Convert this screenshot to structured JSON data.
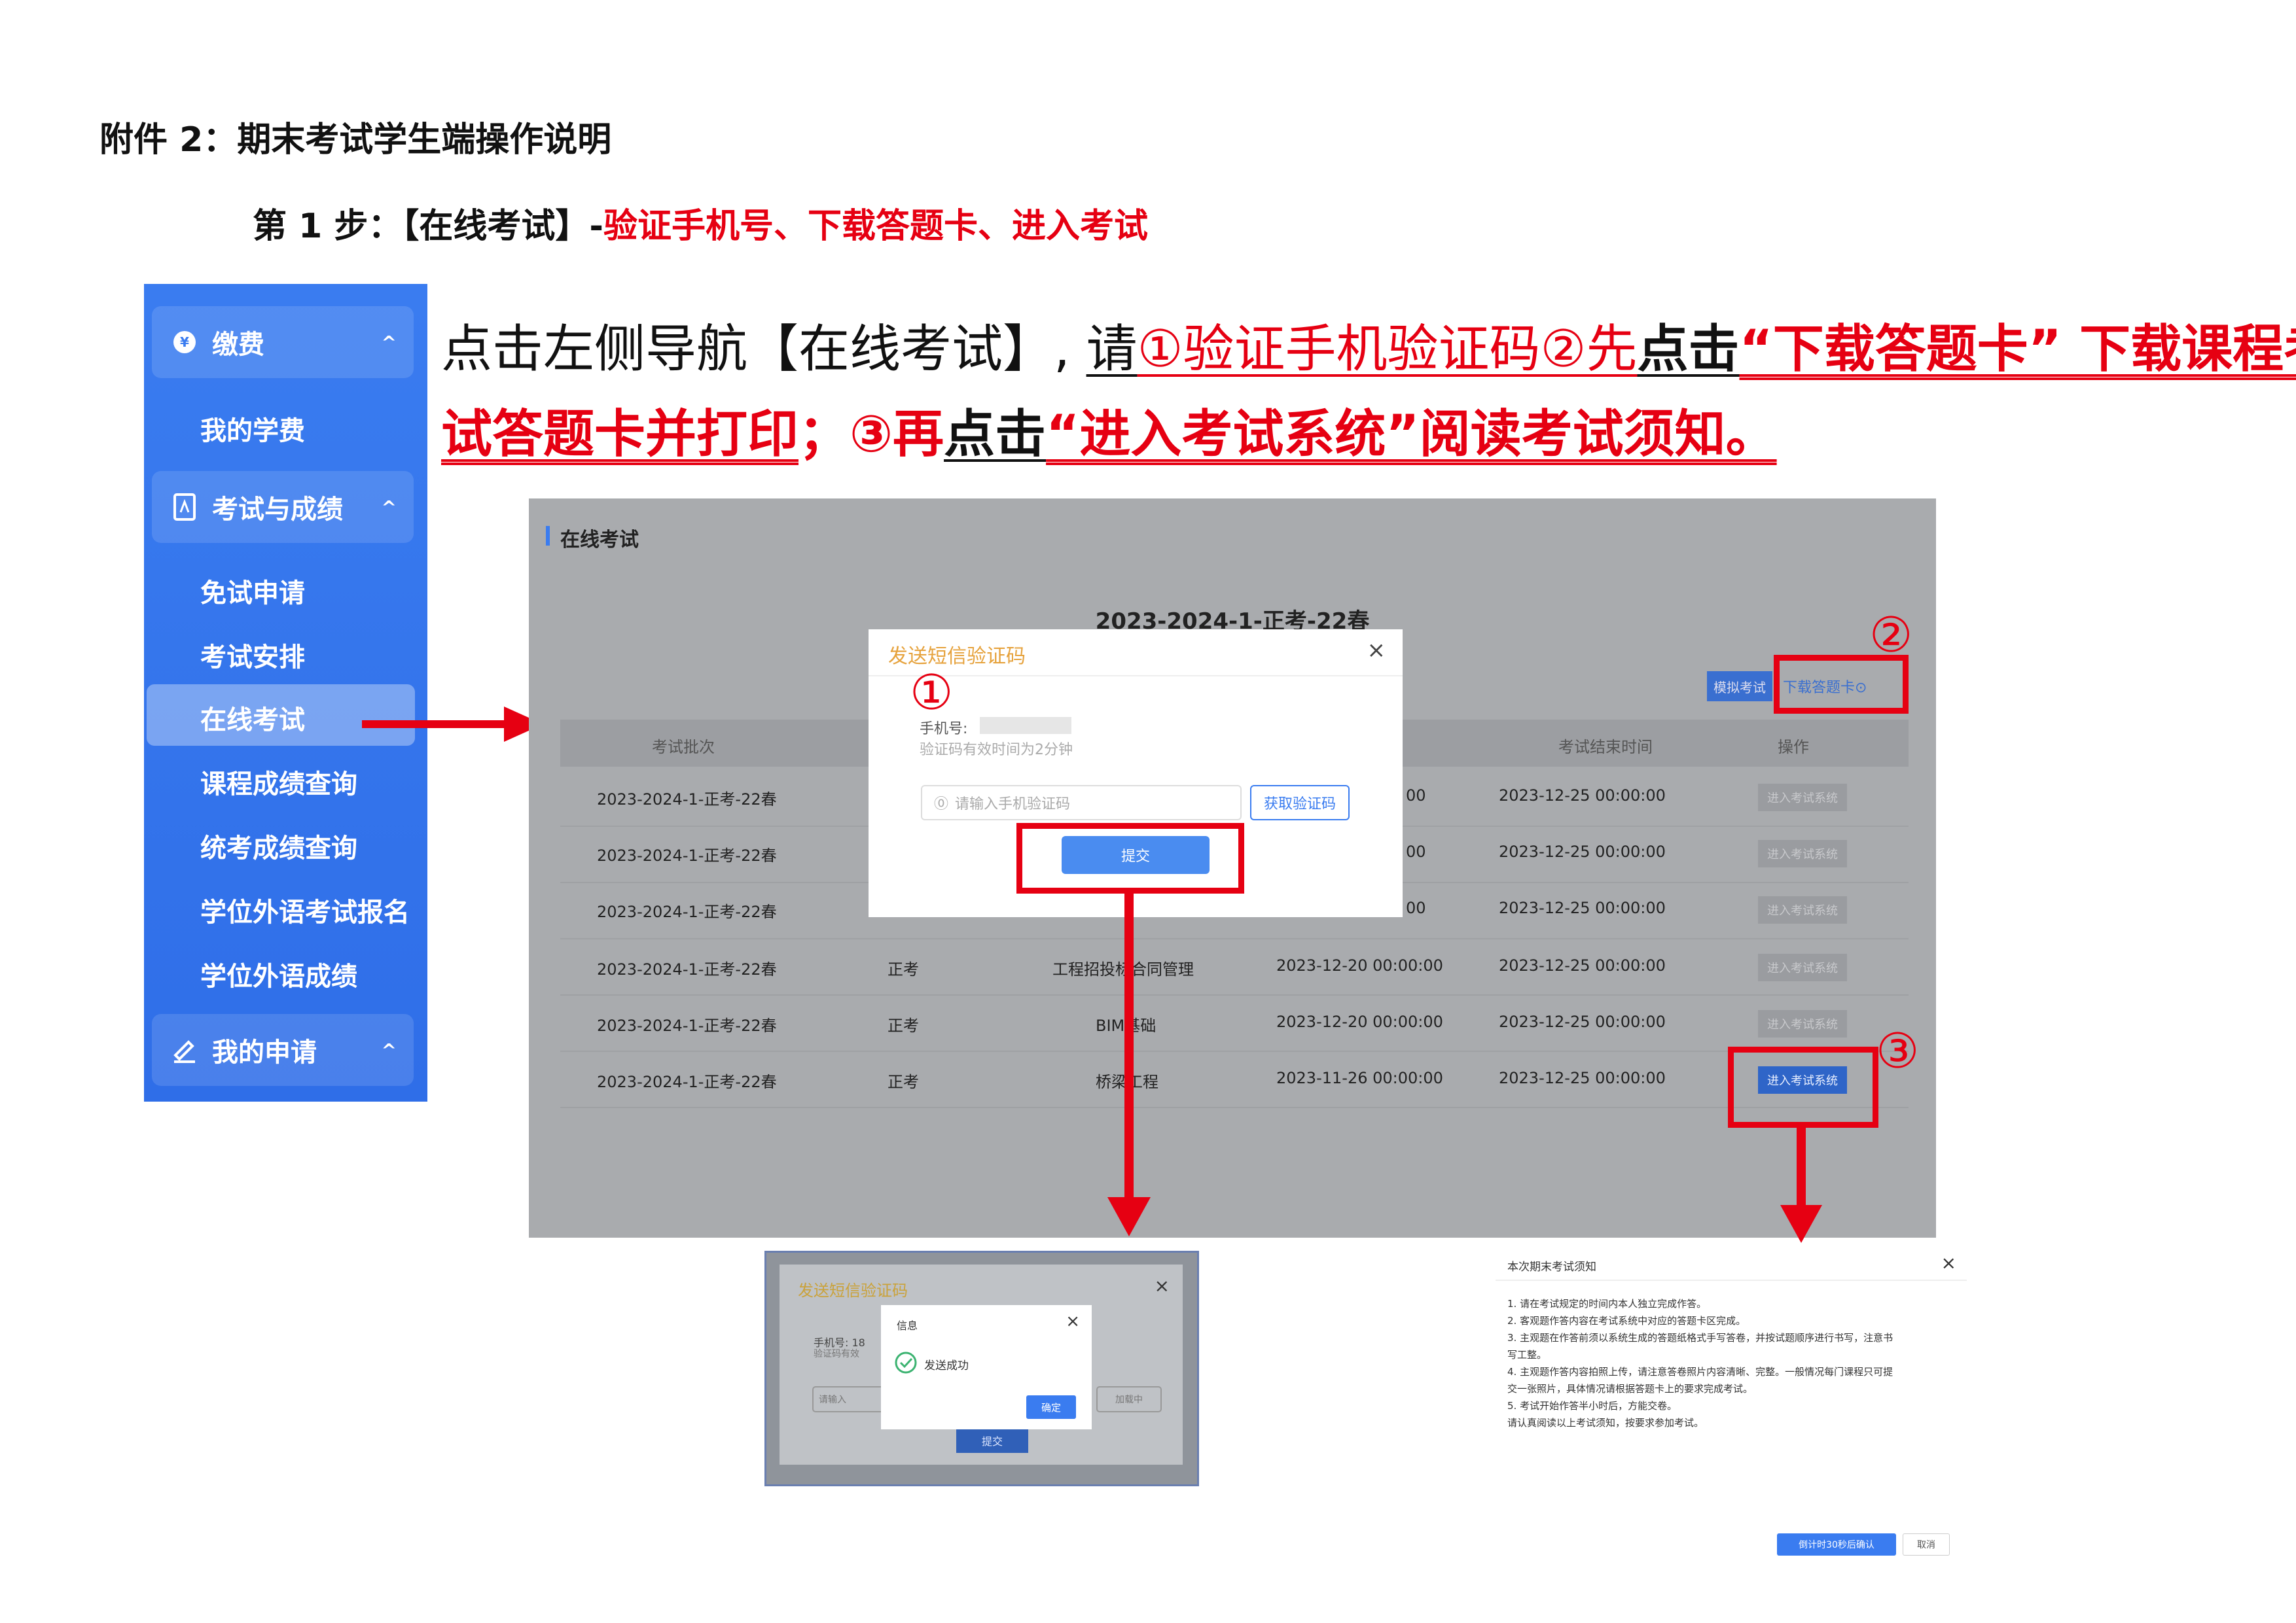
{
  "header": {
    "title": "附件 2：期末考试学生端操作说明",
    "step_prefix": "第 1 步：【在线考试】-",
    "step_red": "验证手机号、下载答题卡、进入考试"
  },
  "sidebar": {
    "groups": [
      {
        "label": "缴费",
        "icon": "coin-icon"
      },
      {
        "label": "考试与成绩",
        "icon": "document-icon"
      },
      {
        "label": "我的申请",
        "icon": "edit-icon"
      }
    ],
    "items": [
      "我的学费",
      "免试申请",
      "考试安排",
      "在线考试",
      "课程成绩查询",
      "统考成绩查询",
      "学位外语考试报名",
      "学位外语成绩"
    ],
    "chevron": "^"
  },
  "instruction": {
    "p1": "点击左侧导航【在线考试】, ",
    "p2": "请",
    "p3": "①验证手机验证码②先",
    "p4": "点击",
    "p5": "“下载答题卡” 下载课程考",
    "p6": "试答题卡并打印",
    "p7": "；③再",
    "p8": "点击",
    "p9": "“进入考试系统”阅读考试须知。"
  },
  "main": {
    "page_title": "在线考试",
    "batch": "2023-2024-1-正考-22春",
    "mock_btn": "模拟考试",
    "download_btn": "下载答题卡⊙",
    "headers": [
      "考试批次",
      "考试结束时间",
      "操作"
    ],
    "rows": [
      {
        "batch": "2023-2024-1-正考-22春",
        "type": "",
        "course": "",
        "start": "00",
        "end": "2023-12-25 00:00:00"
      },
      {
        "batch": "2023-2024-1-正考-22春",
        "type": "",
        "course": "",
        "start": "00",
        "end": "2023-12-25 00:00:00"
      },
      {
        "batch": "2023-2024-1-正考-22春",
        "type": "",
        "course": "",
        "start": "00",
        "end": "2023-12-25 00:00:00"
      },
      {
        "batch": "2023-2024-1-正考-22春",
        "type": "正考",
        "course": "工程招投标合同管理",
        "start": "2023-12-20 00:00:00",
        "end": "2023-12-25 00:00:00"
      },
      {
        "batch": "2023-2024-1-正考-22春",
        "type": "正考",
        "course": "BIM基础",
        "start": "2023-12-20 00:00:00",
        "end": "2023-12-25 00:00:00"
      },
      {
        "batch": "2023-2024-1-正考-22春",
        "type": "正考",
        "course": "桥梁工程",
        "start": "2023-11-26 00:00:00",
        "end": "2023-12-25 00:00:00"
      }
    ],
    "enter_btn": "进入考试系统",
    "modal": {
      "title": "发送短信验证码",
      "phone_label": "手机号:",
      "hint": "验证码有效时间为2分钟",
      "placeholder": "请输入手机验证码",
      "get_code": "获取验证码",
      "submit": "提交"
    },
    "markers": [
      "①",
      "②",
      "③"
    ]
  },
  "sms_success": {
    "title": "发送短信验证码",
    "phone": "手机号: 18",
    "hint": "验证码有效",
    "input": "请输入",
    "loading": "加载中",
    "dialog_title": "信息",
    "message": "发送成功",
    "ok": "确定",
    "submit": "提交"
  },
  "notice": {
    "title": "本次期末考试须知",
    "lines": [
      "1. 请在考试规定的时间内本人独立完成作答。",
      "2. 客观题作答内容在考试系统中对应的答题卡区完成。",
      "3. 主观题在作答前须以系统生成的答题纸格式手写答卷，并按试题顺序进行书写，注意书",
      "写工整。",
      "4. 主观题作答内容拍照上传，请注意答卷照片内容清晰、完整。一般情况每门课程只可提",
      "交一张照片，具体情况请根据答题卡上的要求完成考试。",
      "5. 考试开始作答半小时后，方能交卷。",
      "请认真阅读以上考试须知，按要求参加考试。"
    ],
    "confirm": "倒计时30秒后确认",
    "cancel": "取消"
  },
  "colors": {
    "accent": "#3a7cf0",
    "highlight": "#e60012"
  }
}
